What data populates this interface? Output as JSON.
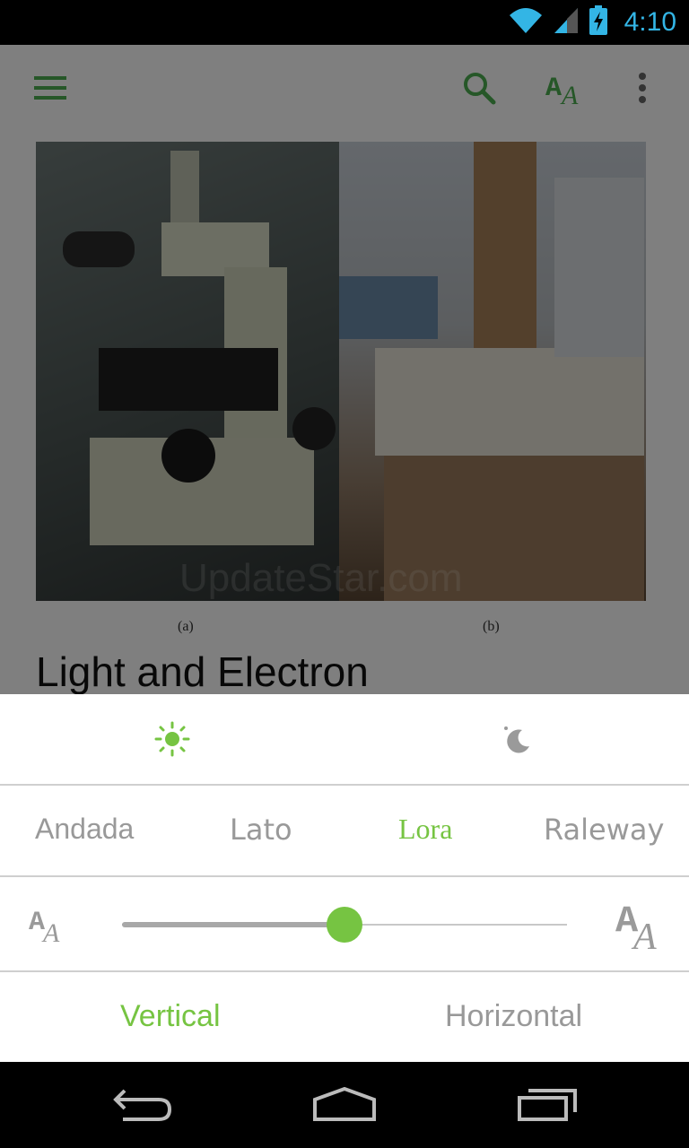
{
  "status_bar": {
    "time": "4:10",
    "accent": "#33b5e5"
  },
  "colors": {
    "accent_green": "#76c442",
    "toolbar_green": "#4caf50",
    "inactive_gray": "#999999"
  },
  "toolbar": {
    "menu_icon": "hamburger-menu-icon",
    "search_icon": "search-icon",
    "text_size_icon": "text-size-icon",
    "overflow_icon": "more-vert-icon"
  },
  "article": {
    "image_captions": [
      "(a)",
      "(b)"
    ],
    "title": "Light and Electron",
    "watermark": "UpdateStar.com"
  },
  "settings": {
    "themes": {
      "light_icon": "sun-icon",
      "dark_icon": "moon-icon",
      "selected": "light"
    },
    "fonts": [
      "Andada",
      "Lato",
      "Lora",
      "Raleway"
    ],
    "selected_font": "Lora",
    "text_size_level": 0.5,
    "orientation": {
      "vertical": "Vertical",
      "horizontal": "Horizontal",
      "selected": "Vertical"
    }
  },
  "nav_bar": {
    "back_icon": "back-icon",
    "home_icon": "home-icon",
    "recents_icon": "recents-icon"
  }
}
